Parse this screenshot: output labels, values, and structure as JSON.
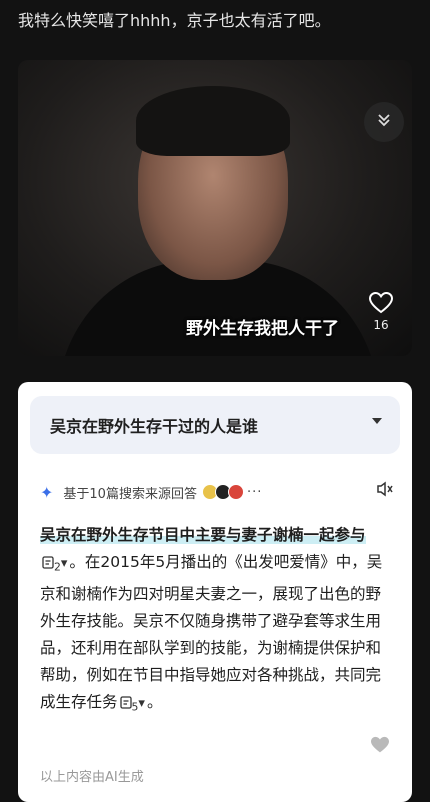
{
  "post": {
    "caption": "我特么快笑嘻了hhhh，京子也太有活了吧。"
  },
  "video": {
    "subtitle": "野外生存我把人干了",
    "like_count": "16",
    "collapse_icon": "chevron-double-down-icon",
    "like_icon": "heart-outline-icon"
  },
  "ai_answer": {
    "question": "吴京在野外生存干过的人是谁",
    "source_label": "基于10篇搜索来源回答",
    "answer_highlight": "吴京在野外生存节目中主要与妻子谢楠一起参与",
    "cite1": "2",
    "answer_rest": "。在2015年5月播出的《出发吧爱情》中，吴京和谢楠作为四对明星夫妻之一，展现了出色的野外生存技能。吴京不仅随身携带了避孕套等求生用品，还利用在部队学到的技能，为谢楠提供保护和帮助，例如在节目中指导她应对各种挑战，共同完成生存任务",
    "cite2": "5",
    "answer_end": "。",
    "footer": "以上内容由AI生成",
    "accent_color": "#3b6fe8",
    "highlight_color": "#cdeef4"
  }
}
